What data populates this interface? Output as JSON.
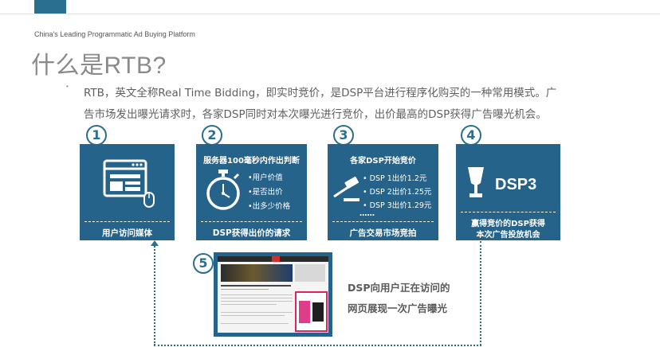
{
  "header": {
    "subtitle": "China's Leading Programmatic Ad Buying Platform",
    "title": "什么是RTB?"
  },
  "description": {
    "line1": "RTB，英文全称Real Time Bidding，即实时竞价，是DSP平台进行程序化购买的一种常用模式。广",
    "line2": "告市场发出曝光请求时，各家DSP同时对本次曝光进行竞价，出价最高的DSP获得广告曝光机会。"
  },
  "steps": {
    "s1": {
      "number": "1",
      "caption": "用户访问媒体",
      "icon": "browser-window-with-mouse-icon"
    },
    "s2": {
      "number": "2",
      "header": "服务器100毫秒内作出判断",
      "items": [
        "•用户价值",
        "•是否出价",
        "•出多少价格"
      ],
      "caption": "DSP获得出价的请求",
      "icon": "stopwatch-icon"
    },
    "s3": {
      "number": "3",
      "header": "各家DSP开始竞价",
      "bids": [
        "• DSP 1出价1.2元",
        "• DSP 2出价1.25元",
        "• DSP 3出价1.29元"
      ],
      "more": "……",
      "caption": "广告交易市场竞拍",
      "icon": "auction-gavel-icon"
    },
    "s4": {
      "number": "4",
      "label": "DSP3",
      "caption_line1": "赢得竞价的DSP获得",
      "caption_line2": "本次广告投放机会",
      "icon": "trophy-icon"
    },
    "s5": {
      "number": "5",
      "text_line1": "DSP向用户正在访问的",
      "text_line2": "网页展现一次广告曝光"
    }
  },
  "colors": {
    "accent": "#26638a",
    "connector": "#2a6f8f",
    "ad_highlight": "#e0245e"
  }
}
